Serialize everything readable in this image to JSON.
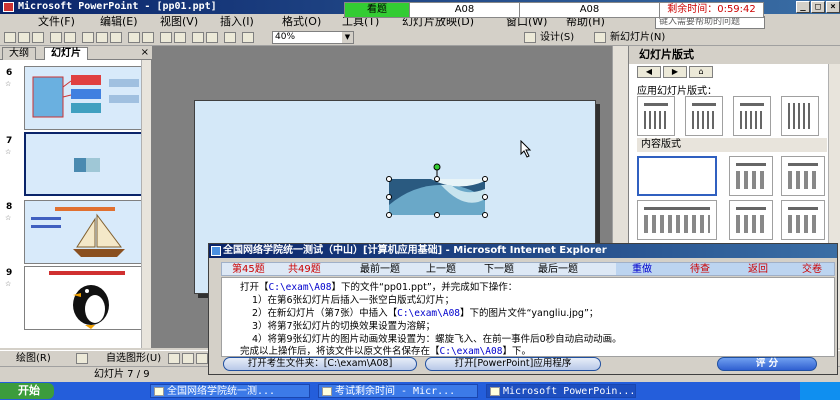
{
  "titlebar": {
    "title": "Microsoft PowerPoint - [pp01.ppt]"
  },
  "menubar": {
    "items": [
      "文件(F)",
      "编辑(E)",
      "视图(V)",
      "插入(I)",
      "格式(O)",
      "工具(T)",
      "幻灯片放映(D)",
      "窗口(W)",
      "帮助(H)"
    ],
    "help_placeholder": "键入需要帮助的问题"
  },
  "exam_timer": {
    "status": "看题",
    "code1": "A08",
    "code2": "A08",
    "remaining": "剩余时间：0:59:42"
  },
  "toolbar": {
    "zoom": "40%",
    "design": "设计(S)",
    "new_slide": "新幻灯片(N)"
  },
  "left_panel": {
    "tabs": [
      "大纲",
      "幻灯片"
    ],
    "active_tab": "幻灯片",
    "slides": [
      "6",
      "7",
      "8",
      "9"
    ],
    "selected_slide": "7"
  },
  "task_pane": {
    "title": "幻灯片版式",
    "apply_label": "应用幻灯片版式：",
    "content_layouts_label": "内容版式"
  },
  "drawbar": {
    "draw": "绘图(R)",
    "autoshapes": "自选图形(U)"
  },
  "status": {
    "slide": "幻灯片 7 / 9"
  },
  "taskbar": {
    "start": "开始",
    "buttons": [
      "全国网络学院统一测...",
      "考试剩余时间 - Micr...",
      "Microsoft PowerPoin..."
    ]
  },
  "exam_window": {
    "title": "全国网络学院统一测试（中山）[计算机应用基础] - Microsoft Internet Explorer",
    "question_no": "第45题",
    "total": "共49题",
    "nav": [
      "最前一题",
      "上一题",
      "下一题",
      "最后一题"
    ],
    "actions": [
      "重做",
      "待查",
      "返回",
      "交卷"
    ],
    "intro_prefix": "打开【",
    "intro_path": "C:\\exam\\A08",
    "intro_suffix": "】下的文件“pp01.ppt”，并完成如下操作：",
    "step1": "1）在第6张幻灯片后插入一张空白版式幻灯片；",
    "step2_prefix": "2）在新幻灯片（第7张）中插入【",
    "step2_path": "C:\\exam\\A08",
    "step2_suffix": "】下的图片文件“yangliu.jpg”；",
    "step3": "3）将第7张幻灯片的切换效果设置为溶解；",
    "step4": "4）将第9张幻灯片的图片动画效果设置为：螺旋飞入、在前一事件后0秒自动启动动画。",
    "save_prefix": "完成以上操作后，将该文件以原文件名保存在【",
    "save_path": "C:\\exam\\A08",
    "save_suffix": "】下。",
    "btn_open_folder": "打开考生文件夹：[C:\\exam\\A08]",
    "btn_open_app": "打开[PowerPoint]应用程序",
    "btn_score": "评  分"
  },
  "colors": {
    "titlebar": "#0a246a",
    "timer_green": "#33cc33",
    "accent_red": "#cc0000",
    "path_blue": "#0000cc"
  }
}
